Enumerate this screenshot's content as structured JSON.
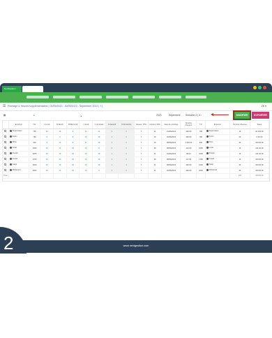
{
  "window": {
    "app_tab": "NextGestion",
    "dot_colors": [
      "#f3c300",
      "#2ecc71",
      "#e74c3c"
    ]
  },
  "header": {
    "title": "Pointage & Heures supplémentaires | 01/09/2023 - 30/09/2023 - Septembre 2023 | × |",
    "right": "ZK ▾"
  },
  "toolbar": {
    "left_icon": "▦",
    "mid_marker": "■",
    "user_marker": "▲",
    "year": "2023",
    "month": "Septembre",
    "period": "Semaine 2 | 4 ›",
    "modify_label": "MODIFIER",
    "export_label": "EXPORTER"
  },
  "table": {
    "columns": [
      "",
      "Employé",
      "T.H.",
      "L\nLundi",
      "M\nMardi",
      "M\nMercredi",
      "J\nJeudi",
      "V\nVendredi",
      "S\nSamedi",
      "D\nDimanche",
      "Heures. 25%",
      "Heures. 50%",
      "Date de pointage",
      "Nombre d'heures",
      "T.P.",
      "Employé",
      "Nombre d'heures",
      "Statut"
    ],
    "rows": [
      {
        "name": "Superviseur",
        "th": "765",
        "l": "12",
        "m": "10",
        "me": "9",
        "j": "12",
        "v": "11",
        "s": "6",
        "d": "0",
        "h25": "7",
        "h50": "21",
        "date": "21/06/2023",
        "nb": "148.00",
        "tp": "765",
        "name2": "Superviseur",
        "nb2": "16",
        "statut": "20:100:00"
      },
      {
        "name": "Karim",
        "th": "780",
        "l": "6",
        "m": "8",
        "me": "8",
        "j": "10",
        "v": "10",
        "s": "3",
        "d": "0",
        "h25": "7",
        "h50": "16",
        "date": "22/06/2023",
        "nb": "148.00",
        "tp": "780",
        "name2": "Karim",
        "nb2": "20",
        "statut": "0.00.00"
      },
      {
        "name": "Driss",
        "th": "630",
        "l": "9",
        "m": "12",
        "me": "8",
        "j": "11",
        "v": "10",
        "s": "2",
        "d": "0",
        "h25": "7",
        "h50": "16",
        "date": "08/06/2023",
        "nb": "1'100.00",
        "tp": "630",
        "name2": "Driss",
        "nb2": "32",
        "statut": "100:00:00"
      },
      {
        "name": "Lindo",
        "th": "1050",
        "l": "10",
        "m": "14",
        "me": "12",
        "j": "10",
        "v": "8",
        "s": "0",
        "d": "0",
        "h25": "7",
        "h50": "28",
        "date": "08/06/2023",
        "nb": "143.00",
        "tp": "1050",
        "name2": "Lindo",
        "nb2": "16",
        "statut": "121:00:00"
      },
      {
        "name": "Zinedo",
        "th": "2205",
        "l": "10",
        "m": "10",
        "me": "10",
        "j": "10",
        "v": "10",
        "s": "1",
        "d": "0",
        "h25": "7",
        "h50": "21",
        "date": "19/06/2023",
        "nb": "99.00",
        "tp": "2205",
        "name2": "Zinedo",
        "nb2": "16",
        "statut": "121:00:00"
      },
      {
        "name": "Fouad",
        "th": "1750",
        "l": "10",
        "m": "20",
        "me": "10",
        "j": "10",
        "v": "10",
        "s": "3",
        "d": "0",
        "h25": "7",
        "h50": "28",
        "date": "08/06/2023",
        "nb": "117.00",
        "tp": "1750",
        "name2": "Fouad",
        "nb2": "16",
        "statut": "100:00:00"
      },
      {
        "name": "Jaagi",
        "th": "1600",
        "l": "10",
        "m": "10",
        "me": "10",
        "j": "10",
        "v": "10",
        "s": "1",
        "d": "3",
        "h25": "7",
        "h50": "21",
        "date": "08/06/2023",
        "nb": "148.00",
        "tp": "1600",
        "name2": "Jaagi",
        "nb2": "32",
        "statut": "100:00:00"
      },
      {
        "name": "Mohamed",
        "th": "2000",
        "l": "10",
        "m": "12",
        "me": "10",
        "j": "10",
        "v": "9",
        "s": "2",
        "d": "0",
        "h25": "7",
        "h50": "21",
        "date": "22/06/2023",
        "nb": "146.00",
        "tp": "2000",
        "name2": "Mohamed",
        "nb2": "32",
        "statut": "100:00:00"
      }
    ],
    "total_label": "Total",
    "total_nb2": "200",
    "total_statut": "100:00:00"
  },
  "footer": {
    "site": "www.nextgestion.com",
    "step": "2"
  }
}
